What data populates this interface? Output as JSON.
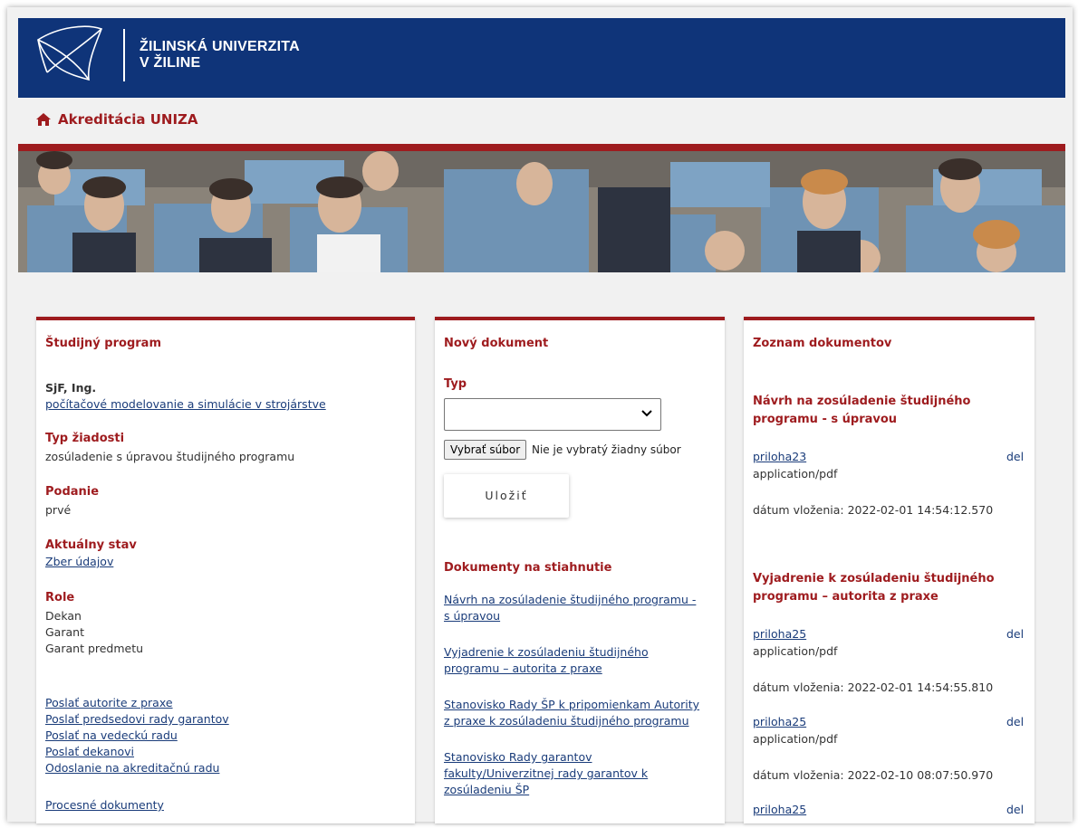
{
  "brand": {
    "line1": "ŽILINSKÁ UNIVERZITA",
    "line2": "V ŽILINE"
  },
  "breadcrumb": {
    "label": "Akreditácia UNIZA"
  },
  "left": {
    "heading": "Študijný program",
    "program_code": "SjF, Ing.",
    "program_name": "počítačové modelovanie a simulácie v strojárstve",
    "type_label": "Typ žiadosti",
    "type_value": "zosúladenie s úpravou študijného programu",
    "podanie_label": "Podanie",
    "podanie_value": "prvé",
    "state_label": "Aktuálny stav",
    "state_value": "Zber údajov",
    "role_label": "Role",
    "roles": [
      "Dekan",
      "Garant",
      "Garant predmetu"
    ],
    "actions": [
      "Poslať autorite z praxe",
      "Poslať predsedovi rady garantov",
      "Poslať na vedeckú radu",
      "Poslať dekanovi",
      "Odoslanie na akreditačnú radu"
    ],
    "process_docs": "Procesné dokumenty"
  },
  "middle": {
    "heading": "Nový dokument",
    "type_label": "Typ",
    "select_value": "",
    "file_button": "Vybrať súbor",
    "file_status": "Nie je vybratý žiadny súbor",
    "save_button": "Uložiť",
    "downloads_heading": "Dokumenty na stiahnutie",
    "downloads": [
      [
        "Návrh na zosúladenie študijného programu -",
        "s úpravou"
      ],
      [
        "Vyjadrenie k zosúladeniu študijného",
        "programu – autorita z praxe"
      ],
      [
        "Stanovisko Rady ŠP k pripomienkam Autority",
        "z praxe k zosúladeniu študijného programu"
      ],
      [
        "Stanovisko Rady garantov",
        "fakulty/Univerzitnej rady garantov k",
        "zosúladeniu ŠP"
      ]
    ]
  },
  "right": {
    "heading": "Zoznam dokumentov",
    "group1": [
      "Návrh na zosúladenie študijného",
      "programu - s úpravou"
    ],
    "group2": [
      "Vyjadrenie k zosúladeniu študijného",
      "programu – autorita z praxe"
    ],
    "del_label": "del",
    "files": [
      {
        "name": "priloha23",
        "mime": "application/pdf",
        "date": "dátum vloženia: 2022-02-01 14:54:12.570"
      },
      {
        "name": "priloha25",
        "mime": "application/pdf",
        "date": "dátum vloženia: 2022-02-01 14:54:55.810"
      },
      {
        "name": "priloha25",
        "mime": "application/pdf",
        "date": "dátum vloženia: 2022-02-10 08:07:50.970"
      },
      {
        "name": "priloha25"
      }
    ]
  }
}
